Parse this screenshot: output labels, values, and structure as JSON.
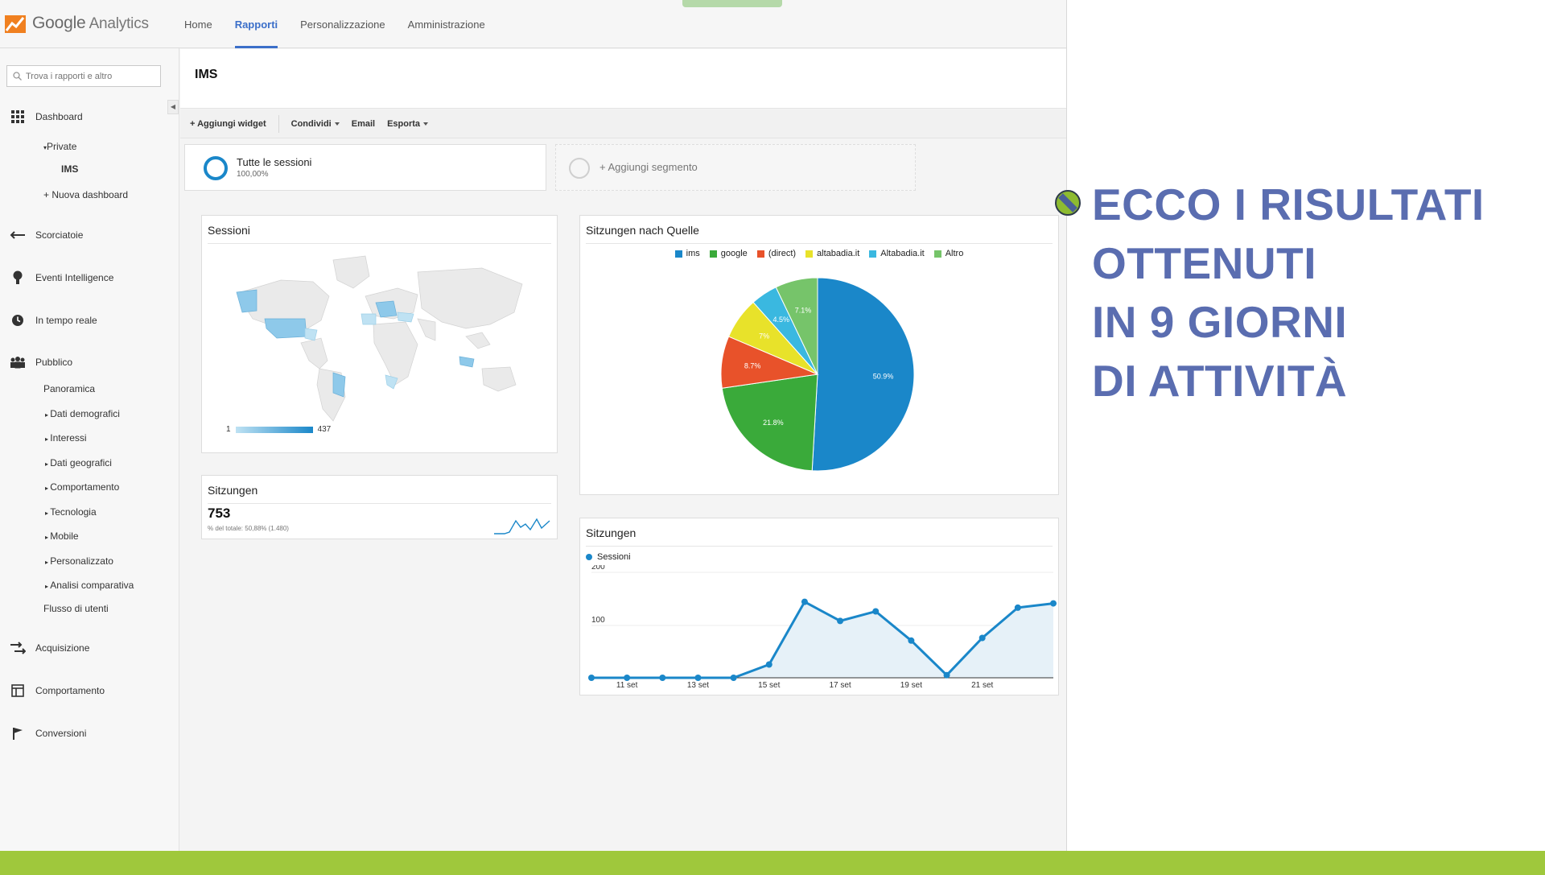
{
  "app": {
    "logo_main": "Google",
    "logo_sub": "Analytics"
  },
  "nav": {
    "items": [
      "Home",
      "Rapporti",
      "Personalizzazione",
      "Amministrazione"
    ],
    "active": "Rapporti"
  },
  "sidebar": {
    "search_placeholder": "Trova i rapporti e altro",
    "dashboard": "Dashboard",
    "private": "Private",
    "ims": "IMS",
    "new_dashboard": "+ Nuova dashboard",
    "shortcuts": "Scorciatoie",
    "intelligence": "Eventi Intelligence",
    "realtime": "In tempo reale",
    "audience": "Pubblico",
    "audience_items": [
      "Panoramica",
      "Dati demografici",
      "Interessi",
      "Dati geografici",
      "Comportamento",
      "Tecnologia",
      "Mobile",
      "Personalizzato",
      "Analisi comparativa",
      "Flusso di utenti"
    ],
    "acquisition": "Acquisizione",
    "behavior": "Comportamento",
    "conversions": "Conversioni"
  },
  "page": {
    "title": "IMS"
  },
  "toolbar": {
    "add_widget": "+ Aggiungi widget",
    "share": "Condividi",
    "email": "Email",
    "export": "Esporta"
  },
  "segments": {
    "all_name": "Tutte le sessioni",
    "all_pct": "100,00%",
    "add": "+ Aggiungi segmento"
  },
  "map_widget": {
    "title": "Sessioni",
    "legend_min": "1",
    "legend_max": "437"
  },
  "sessions_widget": {
    "title": "Sitzungen",
    "value": "753",
    "subtext": "% del totale: 50,88% (1.480)"
  },
  "pie_widget": {
    "title": "Sitzungen nach Quelle"
  },
  "line_widget": {
    "title": "Sitzungen"
  },
  "chart_data": [
    {
      "type": "pie",
      "title": "Sitzungen nach Quelle",
      "labels": [
        "ims",
        "google",
        "(direct)",
        "altabadia.it",
        "Altabadia.it",
        "Altro"
      ],
      "values": [
        50.9,
        21.8,
        8.7,
        7,
        4.5,
        7.1
      ],
      "slice_labels": [
        "50.9%",
        "21.8%",
        "8.7%",
        "7%",
        "4.5%",
        "7.1%"
      ],
      "colors": [
        "#1a87c9",
        "#3aaa3a",
        "#e8522a",
        "#e8e22a",
        "#3ab8e0",
        "#76c46a"
      ],
      "legend": "top"
    },
    {
      "type": "line",
      "title": "Sitzungen",
      "series": [
        {
          "name": "Sessioni",
          "values": [
            0,
            0,
            0,
            0,
            0,
            25,
            143,
            107,
            125,
            70,
            5,
            75,
            132,
            140
          ]
        }
      ],
      "x_ticks": [
        "11 set",
        "13 set",
        "15 set",
        "17 set",
        "19 set",
        "21 set"
      ],
      "y_ticks": [
        "200",
        "100"
      ],
      "ylim": [
        0,
        200
      ],
      "color": "#1a87c9",
      "fill": "#e6f1f8"
    }
  ],
  "headline": {
    "lines": [
      "ECCO I RISULTATI",
      "OTTENUTI",
      "IN 9 GIORNI",
      "DI ATTIVITÀ"
    ],
    "color": "#5a6db0"
  },
  "colors": {
    "bottom_bar": "#9fc83c",
    "accent_blue": "#3b6fc9"
  }
}
